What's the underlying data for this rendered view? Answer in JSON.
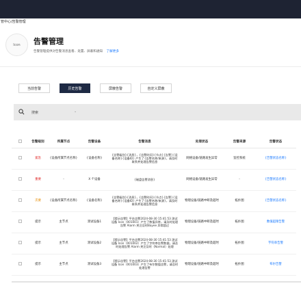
{
  "breadcrumb": "管中心/告警管理",
  "header": {
    "avatar_text": "Icon",
    "title": "告警管理",
    "description": "告警管理提供对告警消息查看、处置、屏蔽和通知",
    "link": "了解更多"
  },
  "tabs": [
    {
      "label": "当前告警",
      "active": false
    },
    {
      "label": "历史告警",
      "active": true
    },
    {
      "label": "屏蔽告警",
      "active": false
    },
    {
      "label": "自定义屏蔽",
      "active": false
    }
  ],
  "search": {
    "placeholder": "搜索"
  },
  "table": {
    "columns": [
      "告警级别",
      "所属节点",
      "告警设备",
      "告警消息",
      "处理状态",
      "告警来源",
      "告警状态"
    ],
    "rows": [
      {
        "level": "紧急",
        "level_color": "red",
        "node": "{设备所属节点名称}",
        "device": "{设备名称}",
        "message": "{告警级别}{消息}，{告警时间}{节点}{告警}{设备名称}{设备ID} 产生了{告警名称/来源}，请及时联系并处理告警信息",
        "status": "网络设备/链路发生异常",
        "source": "监控系统",
        "state": "{告警状态名称}"
      },
      {
        "level": "重要",
        "level_color": "red",
        "node": "-",
        "device": "X 个设备",
        "message": "{磁盘告警消息}",
        "status": "网络设备/链路发生异常",
        "source": "-",
        "state": "{告警状态名称}"
      },
      {
        "level": "次要",
        "level_color": "orange",
        "node": "{设备所属节点名称}",
        "device": "{设备名称}",
        "message": "{告警级别}{消息}，{告警时间}{节点}{告警}{设备名称}{设备ID} 产生了{告警名称/来源}，请及时联系并处理告警信息",
        "status": "物理设备/链路中断及超时",
        "source": "拓扑图",
        "state": "{告警状态名称}"
      },
      {
        "level": "提示",
        "level_color": "default",
        "node": "主节点",
        "device": "测试设备1",
        "message": "【提示告警】平台告警2024-08-30 15:41:53 测试设备 Icon（001001）产生了数值异常，请及时处理告警 Alarm 关注及时Bayee 异常超过",
        "status": "物理设备/链路中断及超时",
        "source": "拓扑图",
        "state": "数值超限告警"
      },
      {
        "level": "提示",
        "level_color": "default",
        "node": "主节点",
        "device": "测试设备2",
        "message": "【提示告警】平台告警2024-08-30 15:41:53 测试设备 Icon（001002）产生了字符串告警数据，请及时处理告警 Alarm 关注及时（Normal）处理",
        "status": "物理设备/链路中断及超时",
        "source": "拓扑图",
        "state": "字符串告警"
      },
      {
        "level": "提示",
        "level_color": "default",
        "node": "主节点",
        "device": "测试设备3",
        "message": "【提示告警】平台告警2024-08-30 15:41:53 测试设备 Icon（001003）产生了布尔数值告警，请及时处理告警",
        "status": "物理设备/链路中断及超时",
        "source": "拓扑图",
        "state": "布尔告警"
      }
    ]
  }
}
